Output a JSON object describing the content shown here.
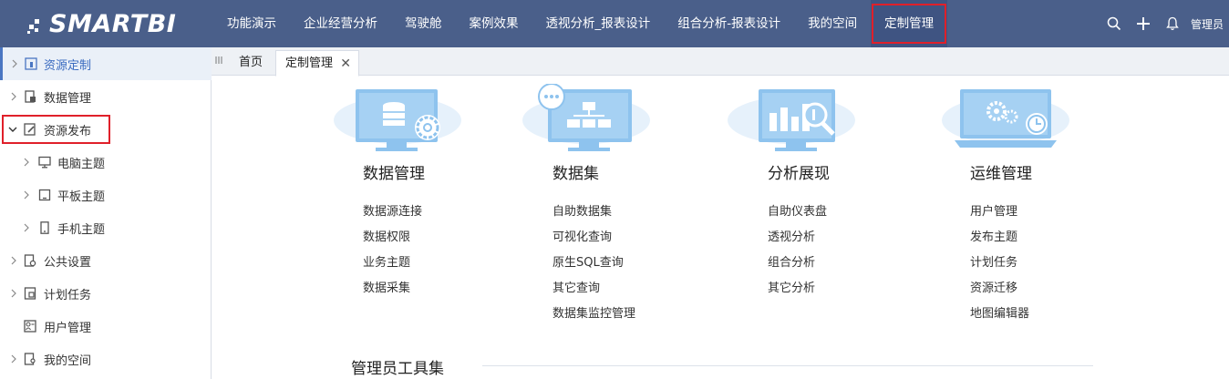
{
  "brand": {
    "logo_text": "SMARTBI"
  },
  "nav": {
    "items": [
      "功能演示",
      "企业经营分析",
      "驾驶舱",
      "案例效果",
      "透视分析_报表设计",
      "组合分析-报表设计",
      "我的空间",
      "定制管理"
    ],
    "active_index": 7
  },
  "topbar": {
    "user_label": "管理员"
  },
  "sidebar": {
    "items": [
      {
        "label": "资源定制",
        "icon": "resource-custom-icon",
        "expanded": false
      },
      {
        "label": "数据管理",
        "icon": "data-manage-icon",
        "expanded": false
      },
      {
        "label": "资源发布",
        "icon": "publish-icon",
        "expanded": true
      },
      {
        "label": "电脑主题",
        "icon": "desktop-icon",
        "expanded": false
      },
      {
        "label": "平板主题",
        "icon": "tablet-icon",
        "expanded": false
      },
      {
        "label": "手机主题",
        "icon": "phone-icon",
        "expanded": false
      },
      {
        "label": "公共设置",
        "icon": "settings-doc-icon",
        "expanded": false
      },
      {
        "label": "计划任务",
        "icon": "schedule-icon",
        "expanded": false
      },
      {
        "label": "用户管理",
        "icon": "user-manage-icon",
        "expanded": false
      },
      {
        "label": "我的空间",
        "icon": "my-space-icon",
        "expanded": false
      }
    ]
  },
  "tabs": {
    "home": "首页",
    "active": "定制管理",
    "close": "✕"
  },
  "modules": [
    {
      "title": "数据管理",
      "links": [
        "数据源连接",
        "数据权限",
        "业务主题",
        "数据采集"
      ]
    },
    {
      "title": "数据集",
      "links": [
        "自助数据集",
        "可视化查询",
        "原生SQL查询",
        "其它查询",
        "数据集监控管理"
      ]
    },
    {
      "title": "分析展现",
      "links": [
        "自助仪表盘",
        "透视分析",
        "组合分析",
        "其它分析"
      ]
    },
    {
      "title": "运维管理",
      "links": [
        "用户管理",
        "发布主题",
        "计划任务",
        "资源迁移",
        "地图编辑器"
      ]
    }
  ],
  "tools": {
    "title": "管理员工具集"
  },
  "colors": {
    "topbar": "#4a5f8a",
    "highlight": "#e0202a",
    "illustration": "#8ec3ee",
    "illustration_bg": "#e6f1fb"
  }
}
